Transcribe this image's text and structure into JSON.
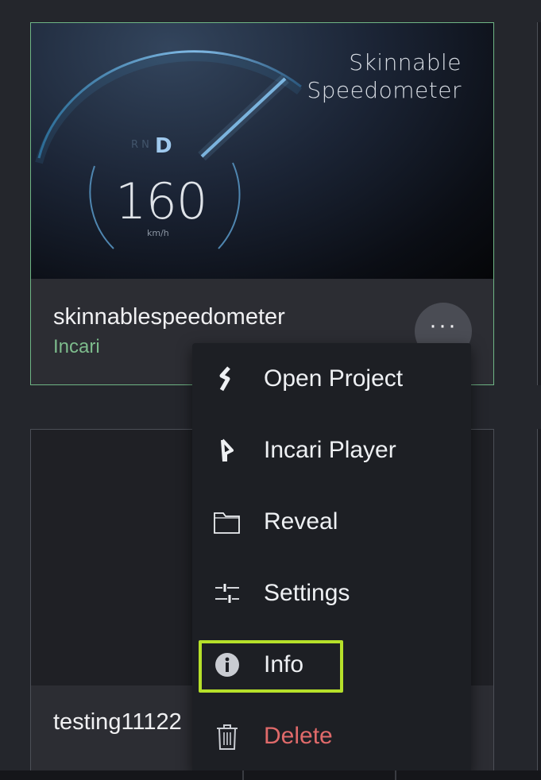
{
  "project_card": {
    "thumbnail": {
      "title_line1": "Skinnable",
      "title_line2": "Speedometer",
      "gear_selected": "D",
      "gear_other": "R N",
      "speed": "160",
      "unit": "km/h"
    },
    "name": "skinnablespeedometer",
    "subtitle": "Incari",
    "more_label": "···"
  },
  "second_card": {
    "name": "testing11122"
  },
  "context_menu": {
    "items": [
      {
        "label": "Open Project",
        "icon": "incari-logo-icon"
      },
      {
        "label": "Incari Player",
        "icon": "player-icon"
      },
      {
        "label": "Reveal",
        "icon": "folder-icon"
      },
      {
        "label": "Settings",
        "icon": "sliders-icon"
      },
      {
        "label": "Info",
        "icon": "info-icon"
      },
      {
        "label": "Delete",
        "icon": "trash-icon"
      }
    ],
    "highlighted_item": "Info"
  },
  "colors": {
    "selected_border": "#6fb585",
    "subtitle": "#7dbb8c",
    "delete": "#e06a6a",
    "highlight": "#b6e02a"
  }
}
